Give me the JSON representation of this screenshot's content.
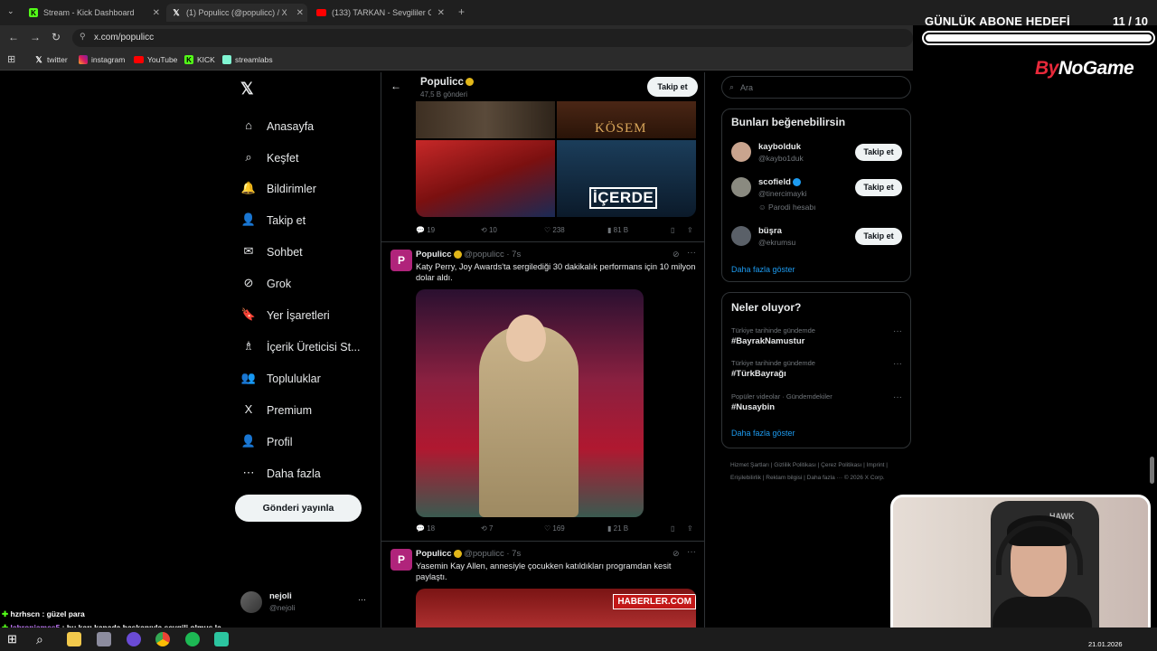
{
  "browser": {
    "tabs": [
      {
        "label": "Stream - Kick Dashboard",
        "icon": "kick-icon"
      },
      {
        "label": "(1) Populicc (@populicc) / X",
        "icon": "x-icon"
      },
      {
        "label": "(133) TARKAN - Sevgililer Günü",
        "icon": "youtube-icon"
      }
    ],
    "new_tab": "+",
    "url": "x.com/populicc",
    "bookmarks": [
      "twitter",
      "instagram",
      "YouTube",
      "KICK",
      "streamlabs"
    ]
  },
  "overlay": {
    "goal_title": "GÜNLÜK ABONE HEDEFİ",
    "goal_count": "11  / 10",
    "goal_progress": 1.0,
    "brand_prefix": "By",
    "brand_suffix": "NoGame"
  },
  "nav": {
    "items": [
      {
        "label": "Anasayfa",
        "icon": "home-icon",
        "glyph": "⌂"
      },
      {
        "label": "Keşfet",
        "icon": "search-icon",
        "glyph": "⌕"
      },
      {
        "label": "Bildirimler",
        "icon": "bell-icon",
        "glyph": "🔔"
      },
      {
        "label": "Takip et",
        "icon": "follow-icon",
        "glyph": "👤"
      },
      {
        "label": "Sohbet",
        "icon": "mail-icon",
        "glyph": "✉"
      },
      {
        "label": "Grok",
        "icon": "grok-icon",
        "glyph": "⊘"
      },
      {
        "label": "Yer İşaretleri",
        "icon": "bookmark-icon",
        "glyph": "🔖"
      },
      {
        "label": "İçerik Üreticisi St...",
        "icon": "creator-icon",
        "glyph": "♗"
      },
      {
        "label": "Topluluklar",
        "icon": "communities-icon",
        "glyph": "👥"
      },
      {
        "label": "Premium",
        "icon": "premium-icon",
        "glyph": "X"
      },
      {
        "label": "Profil",
        "icon": "profile-icon",
        "glyph": "👤"
      },
      {
        "label": "Daha fazla",
        "icon": "more-icon",
        "glyph": "⋯"
      }
    ],
    "post_button": "Gönderi yayınla",
    "account_name": "nejoli",
    "account_handle": "@nejoli",
    "account_more": "···"
  },
  "profile": {
    "name": "Populicc",
    "posts": "47,5 B gönderi",
    "follow": "Takip et"
  },
  "tweets": [
    {
      "image_labels": [
        "KÖSEM",
        "İÇERDE"
      ],
      "stats": {
        "replies": "19",
        "reposts": "10",
        "likes": "238",
        "views": "81 B"
      }
    },
    {
      "avatar": "P",
      "name": "Populicc",
      "handle": "@populicc · 7s",
      "text": "Katy Perry, Joy Awards'ta sergilediği 30 dakikalık performans için 10 milyon dolar aldı.",
      "stats": {
        "replies": "18",
        "reposts": "7",
        "likes": "169",
        "views": "21 B"
      }
    },
    {
      "avatar": "P",
      "name": "Populicc",
      "handle": "@populicc · 7s",
      "text": "Yasemin Kay Allen, annesiyle çocukken katıldıkları programdan kesit paylaştı.",
      "image_label": "HABERLER.COM"
    }
  ],
  "sidebar": {
    "search_placeholder": "Ara",
    "who_to_follow_title": "Bunları beğenebilirsin",
    "suggestions": [
      {
        "name": "kaybolduk",
        "handle": "@kaybo1duk",
        "extra": ""
      },
      {
        "name": "scofield",
        "handle": "@tinercimayki",
        "extra": "Parodi hesabı"
      },
      {
        "name": "büşra",
        "handle": "@ekrumsu",
        "extra": ""
      }
    ],
    "follow_label": "Takip et",
    "show_more": "Daha fazla göster",
    "trends_title": "Neler oluyor?",
    "trends": [
      {
        "context": "Türkiye tarihinde gündemde",
        "tag": "#BayrakNamustur"
      },
      {
        "context": "Türkiye tarihinde gündemde",
        "tag": "#TürkBayrağı"
      },
      {
        "context": "Popüler videolar · Gündemdekiler",
        "tag": "#Nusaybin"
      }
    ],
    "trends_more": "Daha fazla göster",
    "footer": "Hizmet Şartları  |  Gizlilik Politikası  |  Çerez Politikası  |  Imprint  |  Erişilebilirlik  |  Reklam bilgisi  |  Daha fazla ···  © 2026 X Corp."
  },
  "chat": [
    {
      "user": "hzrhscn",
      "message": "güzel para"
    },
    {
      "user": "lebronjames5",
      "message": "bu karı kanada başkanıyla sevgili olmuş la"
    }
  ],
  "taskbar": {
    "date": "21.01.2026"
  },
  "webcam": {
    "hat_text": "HAWK"
  }
}
